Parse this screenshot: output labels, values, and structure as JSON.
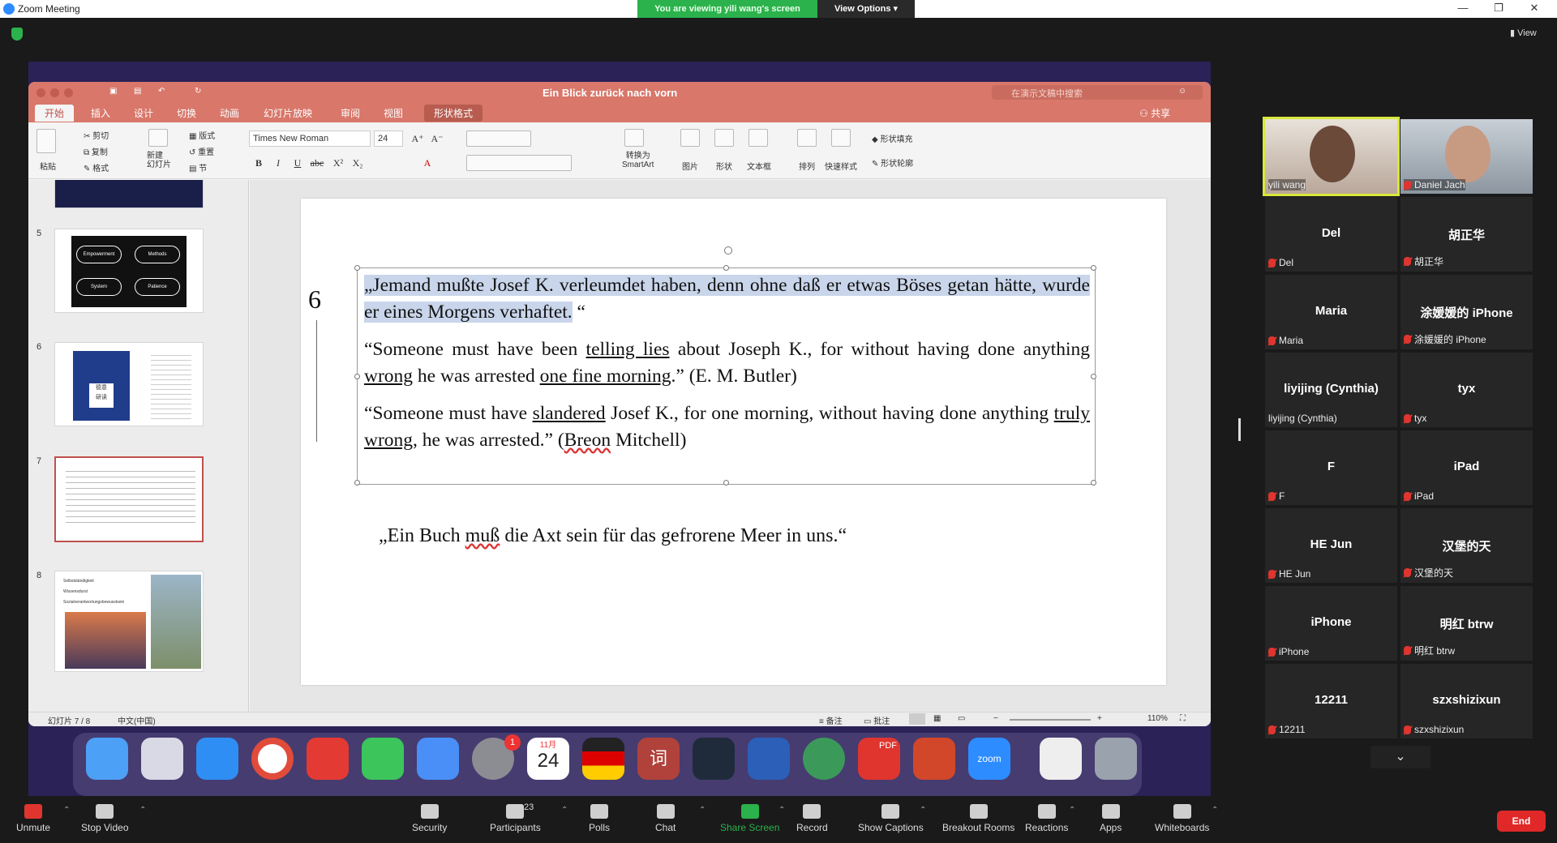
{
  "zoom": {
    "window_title": "Zoom Meeting",
    "viewing_banner": "You are viewing yili wang's screen",
    "view_options": "View Options",
    "view_top": "View",
    "end_label": "End",
    "toolbar": [
      {
        "label": "Unmute",
        "icon": "mic-muted-icon"
      },
      {
        "label": "Stop Video",
        "icon": "video-camera-icon"
      },
      {
        "label": "Security",
        "icon": "shield-icon"
      },
      {
        "label": "Participants",
        "icon": "participants-icon",
        "badge": "23"
      },
      {
        "label": "Polls",
        "icon": "polls-icon"
      },
      {
        "label": "Chat",
        "icon": "chat-icon"
      },
      {
        "label": "Share Screen",
        "icon": "share-screen-icon"
      },
      {
        "label": "Record",
        "icon": "record-icon"
      },
      {
        "label": "Show Captions",
        "icon": "captions-icon"
      },
      {
        "label": "Breakout Rooms",
        "icon": "breakout-rooms-icon"
      },
      {
        "label": "Reactions",
        "icon": "reactions-icon"
      },
      {
        "label": "Apps",
        "icon": "apps-icon"
      },
      {
        "label": "Whiteboards",
        "icon": "whiteboard-icon"
      }
    ],
    "participants": [
      {
        "name": "yili wang",
        "video": true,
        "active_speaker": true,
        "muted": false
      },
      {
        "name": "Daniel Jach",
        "video": true,
        "muted": true
      },
      {
        "name": "Del",
        "muted": true
      },
      {
        "name": "胡正华",
        "muted": true
      },
      {
        "name": "Maria",
        "muted": true
      },
      {
        "name": "涂媛媛的 iPhone",
        "muted": true
      },
      {
        "name": "liyijing (Cynthia)",
        "muted": false
      },
      {
        "name": "tyx",
        "muted": true
      },
      {
        "name": "F",
        "muted": true
      },
      {
        "name": "iPad",
        "muted": true
      },
      {
        "name": "HE Jun",
        "muted": true
      },
      {
        "name": "汉堡的天",
        "muted": true
      },
      {
        "name": "iPhone",
        "muted": true
      },
      {
        "name": "明红 btrw",
        "muted": true
      },
      {
        "name": "12211",
        "muted": true
      },
      {
        "name": "szxshizixun",
        "muted": true
      }
    ]
  },
  "ppt": {
    "doc_title": "Ein Blick zurück nach vorn",
    "search_placeholder": "在演示文稿中搜索",
    "share_label": "共享",
    "tabs": [
      "开始",
      "插入",
      "设计",
      "切换",
      "动画",
      "幻灯片放映",
      "审阅",
      "视图",
      "形状格式"
    ],
    "ribbon": {
      "paste": "粘贴",
      "cut": "剪切",
      "copy": "复制",
      "format": "格式",
      "new_slide": "新建\n幻灯片",
      "layout": "版式",
      "reset": "重置",
      "section": "节",
      "font": "Times New Roman",
      "size": "24",
      "convert_smartart": "转换为\nSmartArt",
      "picture": "图片",
      "shape": "形状",
      "textbox": "文本框",
      "arrange": "排列",
      "quick_styles": "快速样式",
      "shape_fill": "形状填充",
      "shape_outline": "形状轮廓"
    },
    "thumbs": [
      {
        "num": "5",
        "labels": [
          "Empowerment",
          "Methods",
          "System",
          "Patience"
        ]
      },
      {
        "num": "6",
        "labels": [
          "德意\n研读"
        ]
      },
      {
        "num": "7",
        "labels": []
      },
      {
        "num": "8",
        "labels": [
          "Selbstständigkeit",
          "Wissensdurst",
          "Sozialverantwortungsbewusstsein"
        ]
      }
    ],
    "status": {
      "slide": "幻灯片 7 / 8",
      "lang": "中文(中国)",
      "notes": "备注",
      "comments": "批注",
      "zoom": "110%"
    }
  },
  "slide": {
    "number": "6",
    "para1_hl": "„Jemand mußte Josef K. verleumdet haben, denn ohne daß er etwas Böses getan hätte, wurde er eines Morgens verhaftet.",
    "para1_end": " “",
    "para2": {
      "a": "“Someone must have been ",
      "b": "telling lies",
      "c": " about Joseph K., for without having done anything ",
      "d": "wrong",
      "e": " he was arrested ",
      "f": "one fine morning",
      "g": ".” (E. M. Butler)"
    },
    "para3": {
      "a": "“Someone must have ",
      "b": "slandered",
      "c": " Josef K., for one morning, without having done anything ",
      "d": "truly wrong",
      "e": ", he was arrested.”  (",
      "f": "Breon",
      "g": " Mitchell)"
    },
    "quote2": {
      "a": "„Ein Buch ",
      "b": "muß",
      "c": " die Axt sein für das gefrorene Meer in uns.“"
    }
  },
  "dock_apps": [
    "finder-icon",
    "launchpad-icon",
    "safari-icon",
    "chrome-icon",
    "netease-music-icon",
    "wechat-icon",
    "lark-icon",
    "system-preferences-icon",
    "calendar-icon",
    "flag-icon",
    "dictionary-icon",
    "terminal-icon",
    "word-icon",
    "maps-icon",
    "pdf-reader-icon",
    "powerpoint-icon",
    "zoom-icon",
    "preview-icon",
    "trash-icon"
  ],
  "dock": {
    "calendar_month": "11月",
    "calendar_day": "24",
    "settings_badge": "1",
    "zoom_label": "zoom",
    "pdf_label": "PDF",
    "dict_label": "词"
  }
}
